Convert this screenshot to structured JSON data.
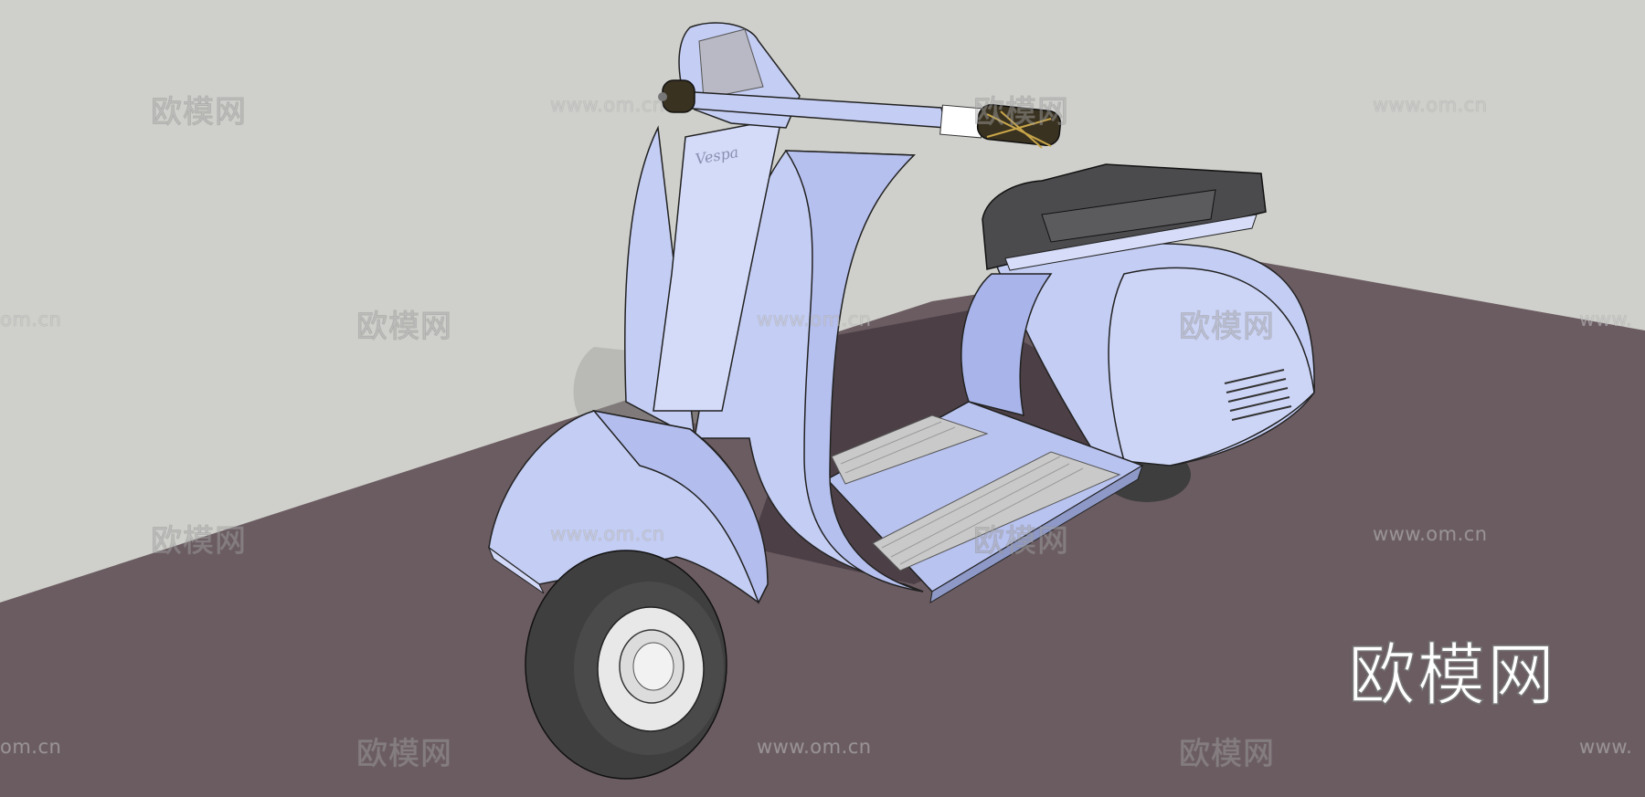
{
  "watermark": {
    "brand": "欧模网",
    "url": "www.om.cn",
    "url_partial": "om.cn",
    "url_partial_right": "www."
  },
  "logo": {
    "text": "欧模网"
  },
  "colors": {
    "wall": "#cfd0cb",
    "floor": "#6b5c62",
    "body": "#c4cdf3",
    "seat": "#4b4b4e",
    "tire": "#4a4a4a",
    "hub": "#e8e8e8"
  }
}
